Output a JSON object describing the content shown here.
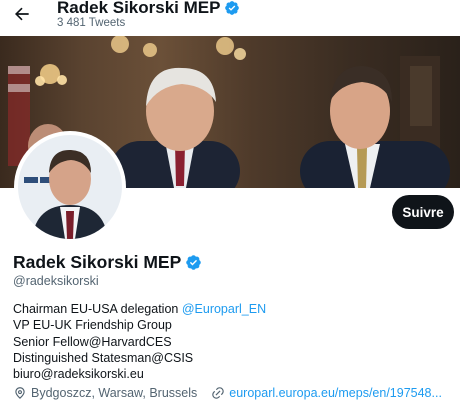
{
  "header": {
    "name": "Radek Sikorski MEP",
    "tweet_count": "3 481 Tweets"
  },
  "profile": {
    "display_name": "Radek Sikorski MEP",
    "handle": "@radeksikorski",
    "follow_label": "Suivre",
    "bio": {
      "line1_text": "Chairman EU-USA delegation ",
      "line1_mention": "@Europarl_EN",
      "line2": "VP EU-UK Friendship Group",
      "line3": "Senior Fellow@HarvardCES",
      "line4": "Distinguished Statesman@CSIS",
      "line5": "biuro@radeksikorski.eu"
    },
    "location": "Bydgoszcz, Warsaw, Brussels",
    "website": "europarl.europa.eu/meps/en/197548..."
  },
  "colors": {
    "accent": "#1d9bf0",
    "text": "#0f1419",
    "secondary": "#536471",
    "button_bg": "#0f1419"
  },
  "icons": {
    "back": "arrow-left-icon",
    "verified": "verified-badge-icon",
    "location": "location-pin-icon",
    "link": "link-icon"
  }
}
